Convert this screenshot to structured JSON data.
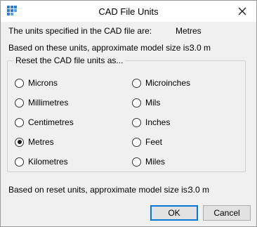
{
  "window": {
    "title": "CAD File Units",
    "icon": "grid-app-icon",
    "close_icon": "close-icon",
    "accent": "#0078d7"
  },
  "info": {
    "units_label": "The units specified in the CAD file are:",
    "units_value": "Metres",
    "size_label": "Based on these units, approximate model size is:",
    "size_value": "3.0 m"
  },
  "group": {
    "label": "Reset the CAD file units as..."
  },
  "units": {
    "microns": "Microns",
    "millimetres": "Millimetres",
    "centimetres": "Centimetres",
    "metres": "Metres",
    "kilometres": "Kilometres",
    "microinches": "Microinches",
    "mils": "Mils",
    "inches": "Inches",
    "feet": "Feet",
    "miles": "Miles",
    "selected": "Metres"
  },
  "reset": {
    "size_label": "Based on reset units, approximate model size is:",
    "size_value": "3.0 m"
  },
  "buttons": {
    "ok": "OK",
    "cancel": "Cancel"
  }
}
